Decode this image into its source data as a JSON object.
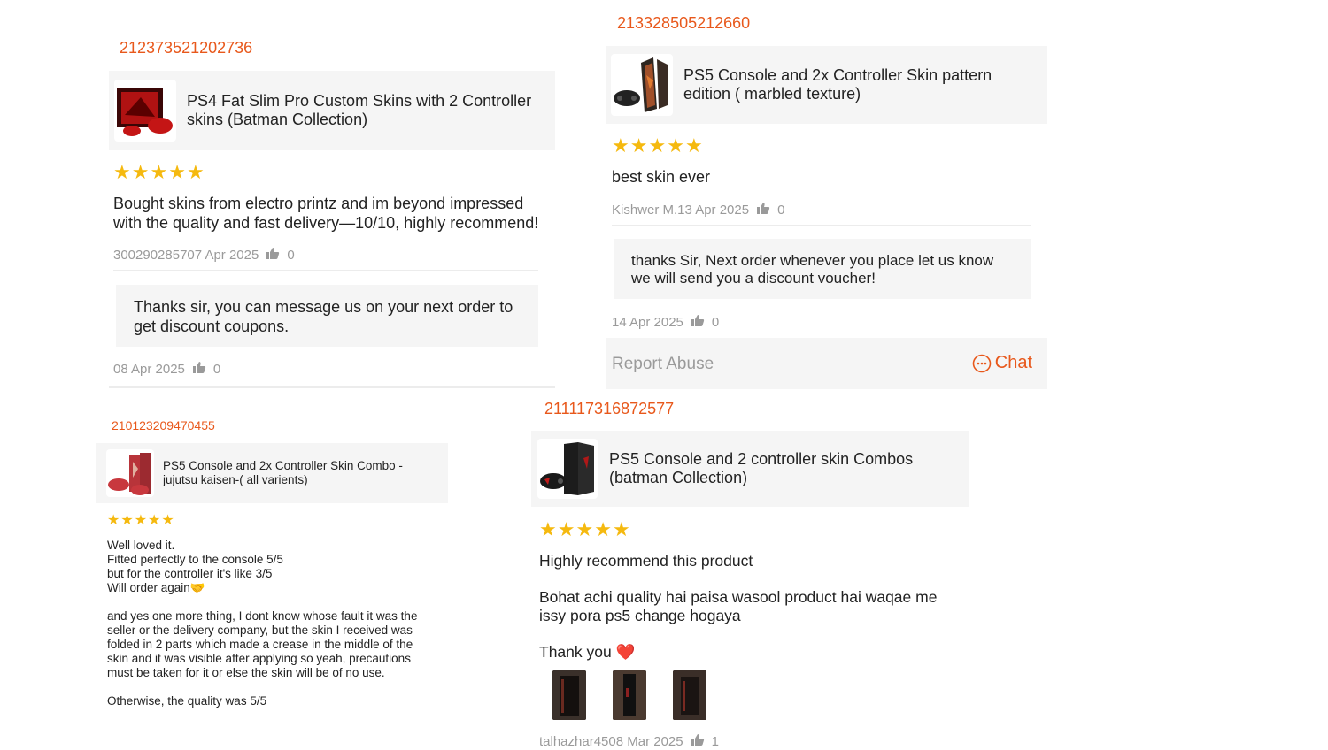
{
  "colors": {
    "accent": "#e8581b",
    "star": "#f5b90f",
    "meta": "#9a9a9a",
    "panel": "#f5f5f5"
  },
  "reviews": [
    {
      "order_id": "212373521202736",
      "product_name": "PS4 Fat Slim Pro Custom Skins with 2 Controller skins (Batman Collection)",
      "rating": 5,
      "text": "Bought skins from electro printz and im beyond impressed with the quality and fast delivery—10/10, highly recommend!",
      "meta": "300290285707 Apr 2025",
      "likes": "0",
      "seller_reply": "Thanks sir, you can message us on your next order to get discount coupons.",
      "reply_meta": "08 Apr 2025",
      "reply_likes": "0"
    },
    {
      "order_id": "213328505212660",
      "product_name": "PS5 Console and 2x Controller Skin pattern edition ( marbled texture)",
      "rating": 5,
      "text": "best skin ever",
      "meta": "Kishwer M.13 Apr 2025",
      "likes": "0",
      "seller_reply": "thanks Sir, Next order whenever you place let us know we will send you a discount voucher!",
      "reply_meta": "14 Apr 2025",
      "reply_likes": "0",
      "report_abuse": "Report Abuse",
      "chat": "Chat",
      "chat_icon": "chat-bubble-icon"
    },
    {
      "order_id": "210123209470455",
      "product_name": "PS5 Console and 2x Controller Skin Combo -jujutsu kaisen-( all varients)",
      "rating": 5,
      "text": "Well loved it.\nFitted perfectly to the console 5/5\nbut for the controller it's like 3/5\nWill order again🤝\n\nand yes one more thing, I dont know whose fault it was the seller or the delivery company, but the skin I received was folded in 2 parts which made a crease in the middle of the skin and it was visible after applying so yeah, precautions must be taken for it or else the skin will be of no use.\n\nOtherwise, the quality was 5/5"
    },
    {
      "order_id": "211117316872577",
      "product_name": "PS5 Console and 2 controller skin Combos (batman Collection)",
      "rating": 5,
      "text": "Highly recommend this product\n\nBohat achi quality hai paisa wasool product hai waqae me issy pora ps5 change hogaya\n\nThank you ❤️",
      "photo_count": 3,
      "meta": "talhazhar4508 Mar 2025",
      "likes": "1"
    }
  ]
}
